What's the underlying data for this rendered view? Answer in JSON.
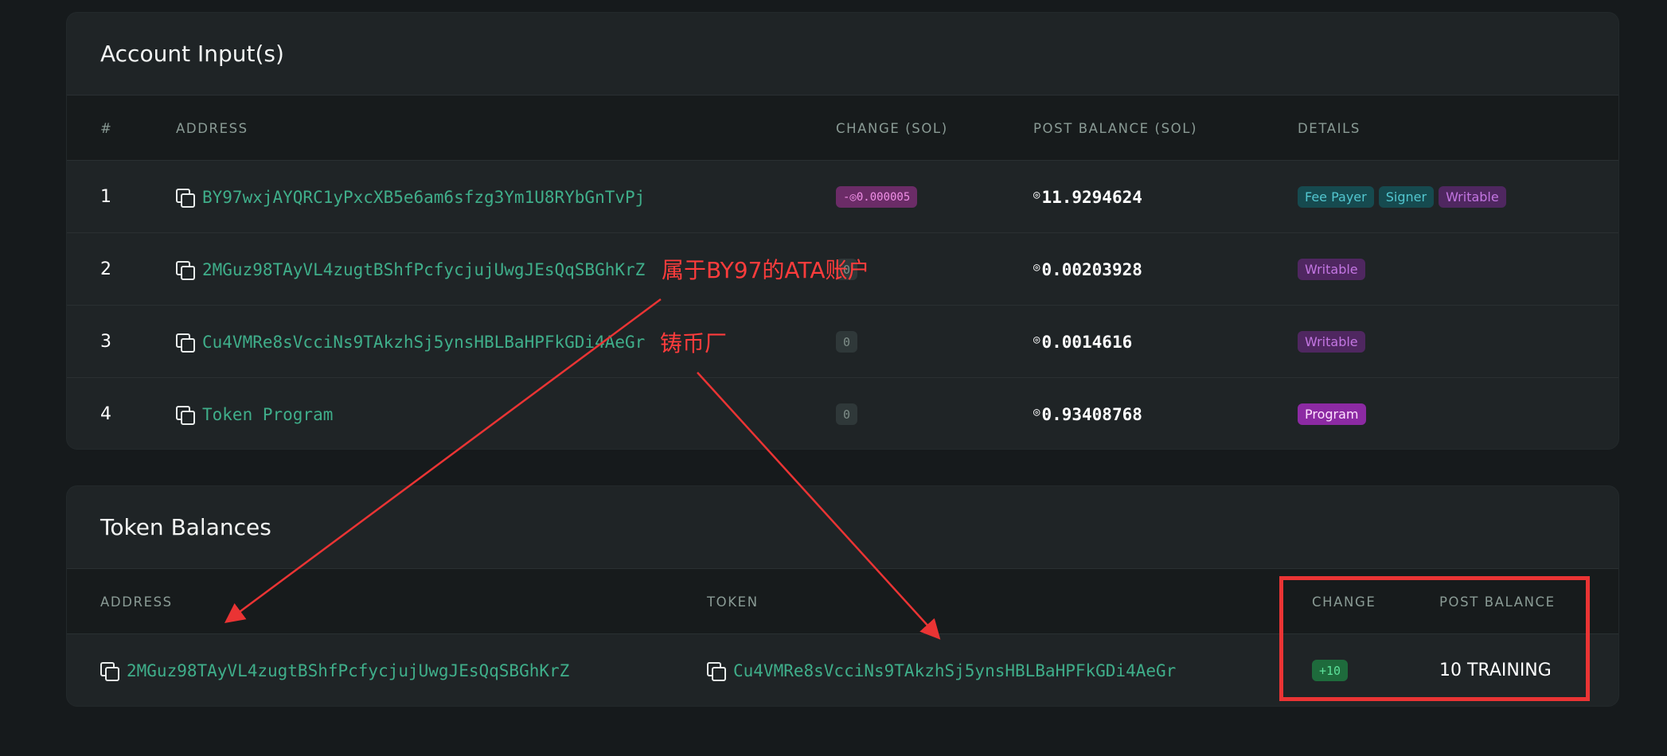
{
  "accounts": {
    "title": "Account Input(s)",
    "headers": {
      "num": "#",
      "address": "ADDRESS",
      "change": "CHANGE (SOL)",
      "post_balance": "POST BALANCE (SOL)",
      "details": "DETAILS"
    },
    "rows": [
      {
        "num": "1",
        "address": "BY97wxjAYQRC1yPxcXB5e6am6sfzg3Ym1U8RYbGnTvPj",
        "change": "-◎0.000005",
        "post_balance": "11.9294624",
        "details": [
          "Fee Payer",
          "Signer",
          "Writable"
        ]
      },
      {
        "num": "2",
        "address": "2MGuz98TAyVL4zugtBShfPcfycjujUwgJEsQqSBGhKrZ",
        "change": "0",
        "post_balance": "0.00203928",
        "details": [
          "Writable"
        ]
      },
      {
        "num": "3",
        "address": "Cu4VMRe8sVcciNs9TAkzhSj5ynsHBLBaHPFkGDi4AeGr",
        "change": "0",
        "post_balance": "0.0014616",
        "details": [
          "Writable"
        ]
      },
      {
        "num": "4",
        "address": "Token Program",
        "change": "0",
        "post_balance": "0.93408768",
        "details": [
          "Program"
        ]
      }
    ]
  },
  "tokens": {
    "title": "Token Balances",
    "headers": {
      "address": "ADDRESS",
      "token": "TOKEN",
      "change": "CHANGE",
      "post_balance": "POST BALANCE"
    },
    "rows": [
      {
        "address": "2MGuz98TAyVL4zugtBShfPcfycjujUwgJEsQqSBGhKrZ",
        "token": "Cu4VMRe8sVcciNs9TAkzhSj5ynsHBLBaHPFkGDi4AeGr",
        "change": "+10",
        "post_balance": "10 TRAINING"
      }
    ]
  },
  "annotations": {
    "ata_note": "属于BY97的ATA账户",
    "mint_note": "铸币厂"
  },
  "icons": {
    "copy": "copy-icon",
    "sol": "◎"
  },
  "colors": {
    "annotation": "#ea3434",
    "address": "#3fae8a"
  }
}
